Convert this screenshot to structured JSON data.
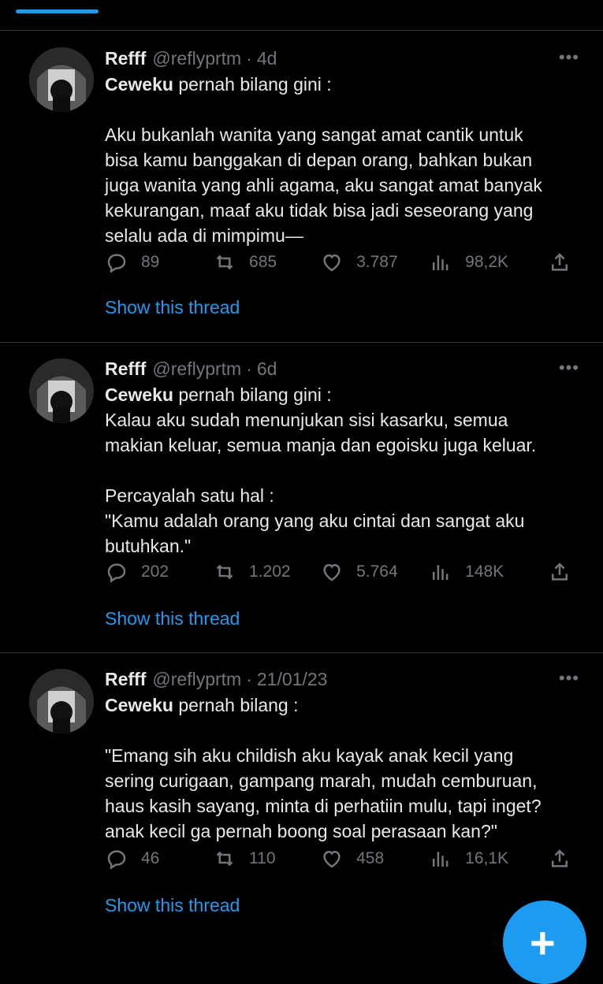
{
  "colors": {
    "background": "#000000",
    "accent": "#1d9bf0",
    "muted": "#71767b",
    "text": "#e7e9ea",
    "divider": "#2f3336"
  },
  "tweets": [
    {
      "name": "Refff",
      "handle": "@reflyprtm",
      "separator": "·",
      "time": "4d",
      "more": "•••",
      "lead_bold": "Ceweku",
      "lead_rest": " pernah bilang gini :",
      "body": "\n\nAku bukanlah wanita yang sangat amat cantik untuk\nbisa kamu banggakan di depan orang, bahkan bukan\njuga wanita yang ahli agama, aku sangat amat banyak\nkekurangan, maaf aku tidak bisa jadi seseorang yang\nselalu ada di mimpimu—",
      "replies": "89",
      "retweets": "685",
      "likes": "3.787",
      "views": "98,2K",
      "thread_link": "Show this thread"
    },
    {
      "name": "Refff",
      "handle": "@reflyprtm",
      "separator": "·",
      "time": "6d",
      "more": "•••",
      "lead_bold": "Ceweku",
      "lead_rest": " pernah bilang gini :",
      "body": "\nKalau aku sudah menunjukan sisi kasarku, semua\nmakian keluar, semua manja dan egoisku juga keluar.\n\nPercayalah satu hal :\n\"Kamu adalah orang yang aku cintai dan sangat aku\nbutuhkan.\"",
      "replies": "202",
      "retweets": "1.202",
      "likes": "5.764",
      "views": "148K",
      "thread_link": "Show this thread"
    },
    {
      "name": "Refff",
      "handle": "@reflyprtm",
      "separator": "·",
      "time": "21/01/23",
      "more": "•••",
      "lead_bold": "Ceweku",
      "lead_rest": " pernah bilang :",
      "body": "\n\n\"Emang sih aku childish aku kayak anak kecil yang\nsering curigaan, gampang marah, mudah cemburuan,\nhaus kasih sayang, minta di perhatiin mulu, tapi inget?\nanak kecil ga pernah boong soal perasaan kan?\"",
      "replies": "46",
      "retweets": "110",
      "likes": "458",
      "views": "16,1K",
      "thread_link": "Show this thread"
    }
  ],
  "fab": {
    "label": "+",
    "icon": "plus-icon"
  }
}
